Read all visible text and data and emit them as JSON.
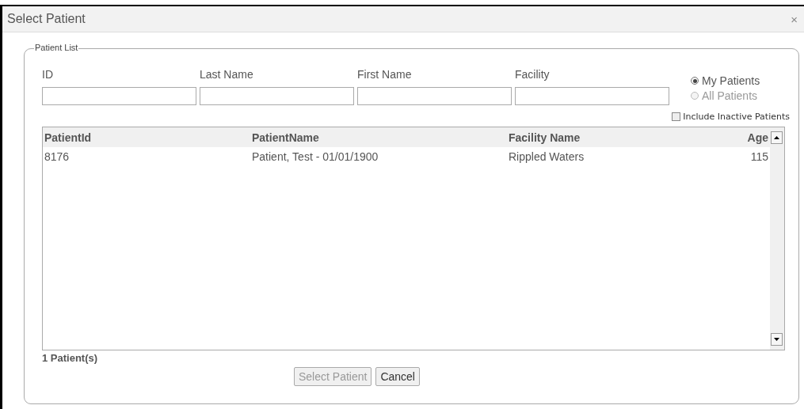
{
  "window": {
    "title": "Select Patient",
    "close": "×"
  },
  "patient_list": {
    "legend": "Patient List",
    "filters": [
      {
        "label": "ID"
      },
      {
        "label": "Last Name"
      },
      {
        "label": "First Name"
      },
      {
        "label": "Facility"
      }
    ],
    "scope": [
      {
        "label": "My Patients",
        "selected": true
      },
      {
        "label": "All Patients",
        "selected": false
      }
    ],
    "include_inactive": {
      "label": "Include Inactive Patients",
      "checked": false
    },
    "table": {
      "columns": [
        "PatientId",
        "PatientName",
        "Facility Name",
        "Age"
      ],
      "rows": [
        [
          "8176",
          "Patient, Test - 01/01/1900",
          "Rippled Waters",
          "115"
        ]
      ]
    },
    "count": "1 Patient(s)"
  },
  "buttons": [
    {
      "label": "Select Patient",
      "disabled": true
    },
    {
      "label": "Cancel",
      "disabled": false
    }
  ]
}
